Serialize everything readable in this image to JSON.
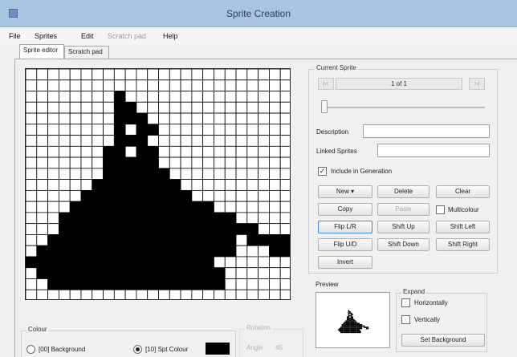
{
  "window": {
    "title": "Sprite Creation"
  },
  "menu": {
    "items": [
      {
        "label": "File",
        "disabled": false
      },
      {
        "label": "Sprites",
        "disabled": false
      },
      {
        "label": "Edit",
        "disabled": false
      },
      {
        "label": "Scratch pad",
        "disabled": true
      },
      {
        "label": "Help",
        "disabled": false
      }
    ]
  },
  "tabs": [
    {
      "label": "Sprite editor",
      "active": true
    },
    {
      "label": "Scratch pad",
      "active": false
    }
  ],
  "sprite_grid": {
    "columns": 24,
    "rows": 21,
    "filled_color": "#000000",
    "empty_color": "#ffffff",
    "pattern": [
      "000000000000000000000000",
      "000000000000000000000000",
      "000000001000000000000000",
      "000000001100000000000000",
      "000000001110000000000000",
      "000000001011000000000000",
      "000000001110000000000000",
      "000000011011000000000000",
      "000000011111000000000000",
      "000000011111100000000000",
      "000000111111110000000000",
      "000001111111111000000000",
      "000011111111111110000000",
      "000111111111111111100000",
      "000111111111111111111000",
      "001111111111111111101111",
      "011111111111111111100011",
      "111111111111111110000000",
      "011111111111111111000000",
      "001111111111111111000000",
      "000000000000000000000000"
    ]
  },
  "current_sprite": {
    "group_label": "Current Sprite",
    "prev_label": "|<",
    "next_label": ">|",
    "counter": "1 of 1",
    "slider_value": 0.0,
    "description_label": "Description",
    "description_value": "",
    "linked_label": "Linked Sprites",
    "linked_value": "",
    "include_label": "Include in Generation",
    "include_checked": true
  },
  "actions": {
    "new": "New",
    "delete": "Delete",
    "clear": "Clear",
    "copy": "Copy",
    "paste": "Paste",
    "multicolour": "Multicolour",
    "multicolour_checked": false,
    "flip_lr": "Flip L/R",
    "shift_up": "Shift Up",
    "shift_left": "Shift Left",
    "flip_ud": "Flip U/D",
    "shift_down": "Shift Down",
    "shift_right": "Shift Right",
    "invert": "Invert"
  },
  "preview": {
    "label": "Preview"
  },
  "expand": {
    "label": "Expand",
    "horizontally": "Horizontally",
    "horizontally_checked": false,
    "vertically": "Vertically",
    "vertically_checked": false,
    "set_background": "Set Background"
  },
  "colour": {
    "label": "Colour",
    "background_option": "[00] Background",
    "background_selected": false,
    "sprite_option": "[10] Spt Colour",
    "sprite_selected": true,
    "swatch_color": "#000000"
  },
  "rotation": {
    "label": "Rotation",
    "angle_label": "Angle",
    "angle_value": "45"
  }
}
